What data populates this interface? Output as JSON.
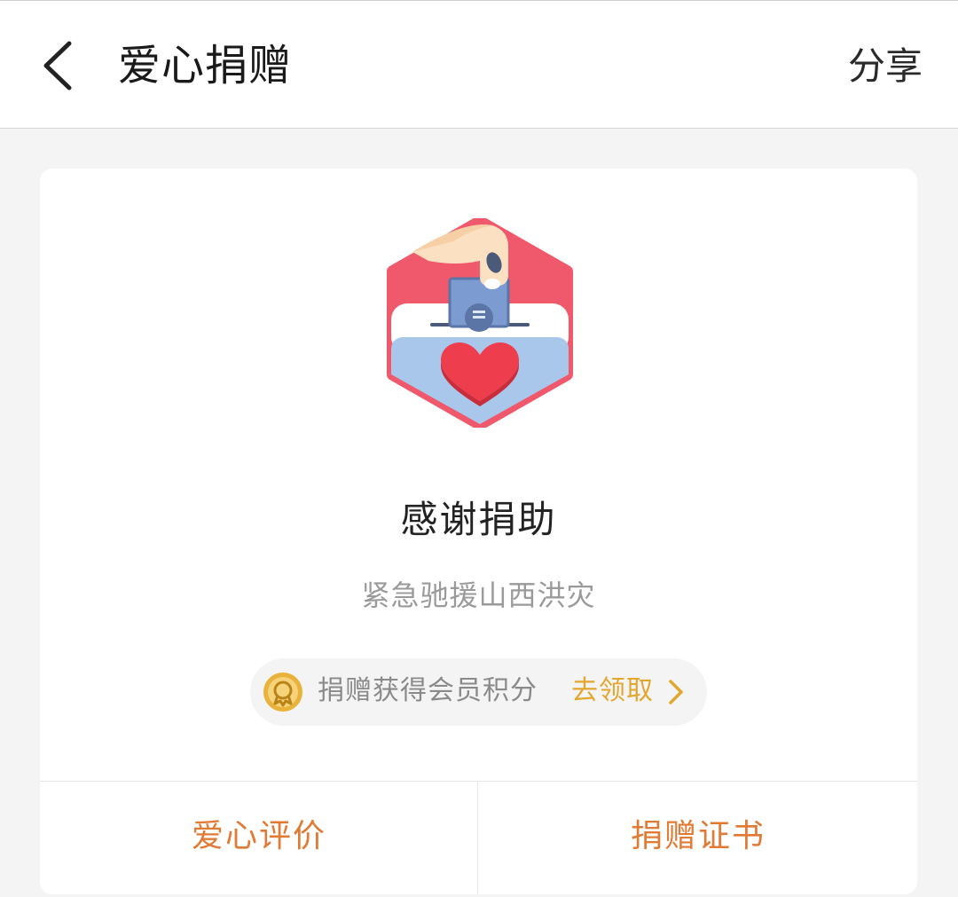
{
  "header": {
    "back_icon": "chevron-left-icon",
    "title": "爱心捐赠",
    "share_label": "分享"
  },
  "card": {
    "hero_icon": "donation-box-heart-icon",
    "title": "感谢捐助",
    "subtitle": "紧急驰援山西洪灾",
    "points": {
      "icon": "medal-icon",
      "text": "捐赠获得会员积分",
      "link_label": "去领取",
      "chevron_icon": "chevron-right-icon"
    },
    "actions": {
      "left_label": "爱心评价",
      "right_label": "捐赠证书"
    }
  },
  "colors": {
    "accent_orange": "#e07a34",
    "link_gold": "#e3a72f",
    "hero_red": "#f0586b",
    "hero_blue": "#a9c7ea",
    "heart_red": "#ee3e4e"
  }
}
